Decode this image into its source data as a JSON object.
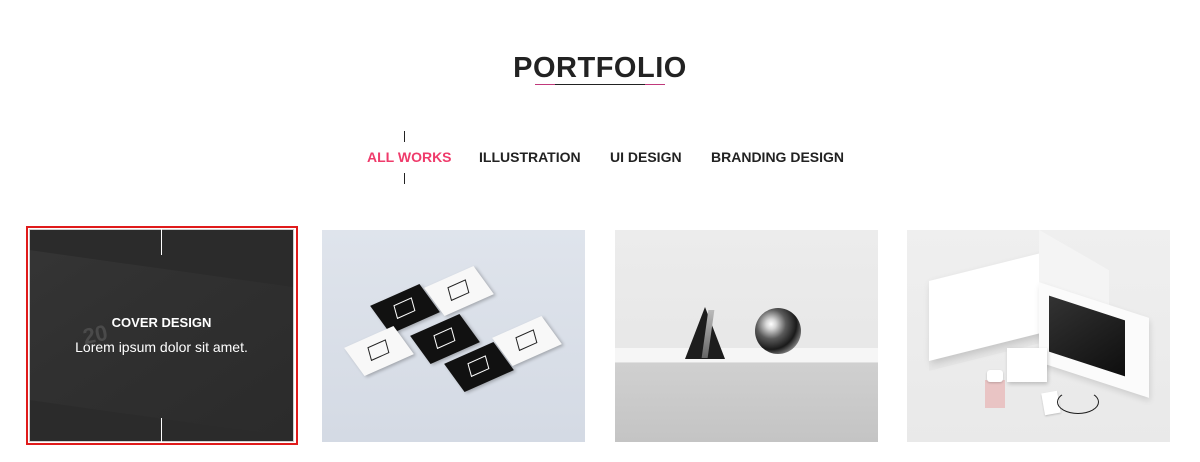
{
  "section": {
    "title": "PORTFOLIO"
  },
  "colors": {
    "accent": "#ef3b6b",
    "text": "#222222",
    "underline_side": "#c0397b",
    "underline_middle": "#222222",
    "highlight_frame": "#e01b1b"
  },
  "filters": {
    "items": [
      {
        "label": "ALL WORKS",
        "active": true
      },
      {
        "label": "ILLUSTRATION",
        "active": false
      },
      {
        "label": "UI DESIGN",
        "active": false
      },
      {
        "label": "BRANDING DESIGN",
        "active": false
      }
    ]
  },
  "portfolio": {
    "items": [
      {
        "image": "dark-cover-book",
        "hover": true,
        "title": "COVER DESIGN",
        "subtitle": "Lorem ipsum dolor sit amet.",
        "number": "20"
      },
      {
        "image": "business-cards-mockup"
      },
      {
        "image": "cone-and-sphere-sculptures"
      },
      {
        "image": "packaging-boxes-mockup"
      }
    ]
  }
}
